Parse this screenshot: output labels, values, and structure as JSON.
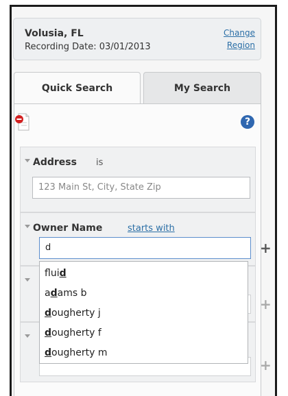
{
  "region": {
    "name": "Volusia, FL",
    "recording_date": "Recording Date: 03/01/2013",
    "change_label_1": "Change",
    "change_label_2": "Region"
  },
  "tabs": [
    {
      "label": "Quick Search",
      "active": true
    },
    {
      "label": "My Search",
      "active": false
    }
  ],
  "toolbar": {
    "pdf_icon": "pdf-icon",
    "help_glyph": "?"
  },
  "address": {
    "label": "Address",
    "operator": "is",
    "placeholder": "123 Main St, City, State Zip"
  },
  "owner": {
    "label": "Owner Name",
    "operator": "starts with",
    "value": "d",
    "add_glyph": "+"
  },
  "suggestions": [
    {
      "pre": "flui",
      "match": "d",
      "post": ""
    },
    {
      "pre": "a",
      "match": "d",
      "post": "ams b"
    },
    {
      "pre": "",
      "match": "d",
      "post": "ougherty j"
    },
    {
      "pre": "",
      "match": "d",
      "post": "ougherty f"
    },
    {
      "pre": "",
      "match": "d",
      "post": "ougherty m"
    }
  ],
  "colors": {
    "link": "#2a6ea6",
    "help_icon": "#2f67b0",
    "pdf_icon_red": "#d22020"
  }
}
